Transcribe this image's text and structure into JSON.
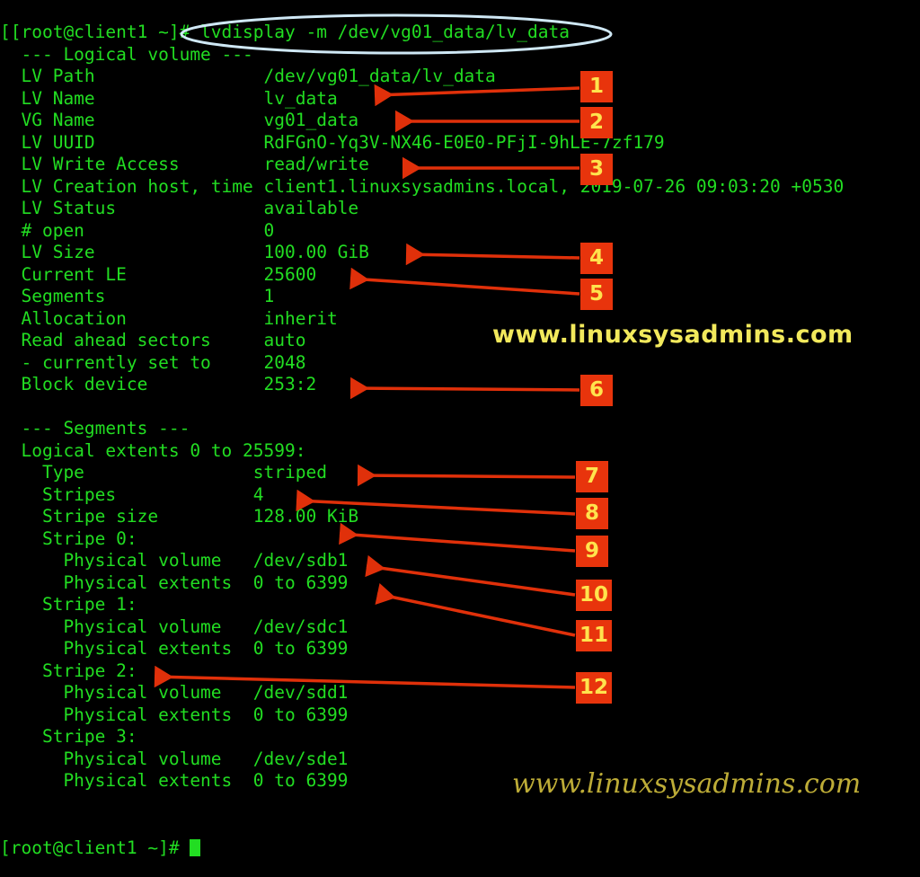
{
  "window": {
    "title": "lvdisplay -m /dev/vg01_data/lv_data",
    "background_color": "#000000",
    "text_color": "#22dd22",
    "badge_color": "#e8340c",
    "badge_text_color": "#ffe34d",
    "arrow_color": "#e0300a",
    "highlight_ellipse_color": "#cfe8f5"
  },
  "terminal": {
    "prompt_line": "[[root@client1 ~]# lvdisplay -m /dev/vg01_data/lv_data",
    "final_prompt": "[root@client1 ~]# ",
    "lines": [
      "[[root@client1 ~]# lvdisplay -m /dev/vg01_data/lv_data",
      "  --- Logical volume ---",
      "  LV Path                /dev/vg01_data/lv_data",
      "  LV Name                lv_data",
      "  VG Name                vg01_data",
      "  LV UUID                RdFGnO-Yq3V-NX46-E0E0-PFjI-9hLE-7zf179",
      "  LV Write Access        read/write",
      "  LV Creation host, time client1.linuxsysadmins.local, 2019-07-26 09:03:20 +0530",
      "  LV Status              available",
      "  # open                 0",
      "  LV Size                100.00 GiB",
      "  Current LE             25600",
      "  Segments               1",
      "  Allocation             inherit",
      "  Read ahead sectors     auto",
      "  - currently set to     2048",
      "  Block device           253:2",
      "",
      "  --- Segments ---",
      "  Logical extents 0 to 25599:",
      "    Type                striped",
      "    Stripes             4",
      "    Stripe size         128.00 KiB",
      "    Stripe 0:",
      "      Physical volume   /dev/sdb1",
      "      Physical extents  0 to 6399",
      "    Stripe 1:",
      "      Physical volume   /dev/sdc1",
      "      Physical extents  0 to 6399",
      "    Stripe 2:",
      "      Physical volume   /dev/sdd1",
      "      Physical extents  0 to 6399",
      "    Stripe 3:",
      "      Physical volume   /dev/sde1",
      "      Physical extents  0 to 6399"
    ],
    "fields": {
      "lv_path": {
        "label": "LV Path",
        "value": "/dev/vg01_data/lv_data"
      },
      "lv_name": {
        "label": "LV Name",
        "value": "lv_data"
      },
      "vg_name": {
        "label": "VG Name",
        "value": "vg01_data"
      },
      "lv_uuid": {
        "label": "LV UUID",
        "value": "RdFGnO-Yq3V-NX46-E0E0-PFjI-9hLE-7zf179"
      },
      "lv_write_access": {
        "label": "LV Write Access",
        "value": "read/write"
      },
      "lv_creation": {
        "label": "LV Creation host, time",
        "value": "client1.linuxsysadmins.local, 2019-07-26 09:03:20 +0530"
      },
      "lv_status": {
        "label": "LV Status",
        "value": "available"
      },
      "open_count": {
        "label": "# open",
        "value": "0"
      },
      "lv_size": {
        "label": "LV Size",
        "value": "100.00 GiB"
      },
      "current_le": {
        "label": "Current LE",
        "value": "25600"
      },
      "segments": {
        "label": "Segments",
        "value": "1"
      },
      "allocation": {
        "label": "Allocation",
        "value": "inherit"
      },
      "read_ahead": {
        "label": "Read ahead sectors",
        "value": "auto"
      },
      "currently_set_to": {
        "label": "- currently set to",
        "value": "2048"
      },
      "block_device": {
        "label": "Block device",
        "value": "253:2"
      },
      "seg_type": {
        "label": "Type",
        "value": "striped"
      },
      "seg_stripes": {
        "label": "Stripes",
        "value": "4"
      },
      "seg_stripe_size": {
        "label": "Stripe size",
        "value": "128.00 KiB"
      }
    },
    "headers": {
      "logical_volume": "  --- Logical volume ---",
      "segments": "  --- Segments ---",
      "logical_extents": "  Logical extents 0 to 25599:"
    },
    "stripes": [
      {
        "header": "    Stripe 0:",
        "pv_label": "      Physical volume",
        "pv_value": "/dev/sdb1",
        "pe_label": "      Physical extents",
        "pe_value": "0 to 6399"
      },
      {
        "header": "    Stripe 1:",
        "pv_label": "      Physical volume",
        "pv_value": "/dev/sdc1",
        "pe_label": "      Physical extents",
        "pe_value": "0 to 6399"
      },
      {
        "header": "    Stripe 2:",
        "pv_label": "      Physical volume",
        "pv_value": "/dev/sdd1",
        "pe_label": "      Physical extents",
        "pe_value": "0 to 6399"
      },
      {
        "header": "    Stripe 3:",
        "pv_label": "      Physical volume",
        "pv_value": "/dev/sde1",
        "pe_label": "      Physical extents",
        "pe_value": "0 to 6399"
      }
    ]
  },
  "annotations": {
    "badges": [
      {
        "n": "1",
        "target": "LV Path value"
      },
      {
        "n": "2",
        "target": "LV Name / VG Name value"
      },
      {
        "n": "3",
        "target": "LV Write Access value"
      },
      {
        "n": "4",
        "target": "LV Size value"
      },
      {
        "n": "5",
        "target": "Current LE value"
      },
      {
        "n": "6",
        "target": "Block device value"
      },
      {
        "n": "7",
        "target": "Type striped"
      },
      {
        "n": "8",
        "target": "Stripes 4"
      },
      {
        "n": "9",
        "target": "Stripe size"
      },
      {
        "n": "10",
        "target": "Stripe 0 physical volume"
      },
      {
        "n": "11",
        "target": "Stripe 0 physical extents"
      },
      {
        "n": "12",
        "target": "Stripe 2 header"
      }
    ]
  },
  "watermarks": {
    "top": "www.linuxsysadmins.com",
    "bottom": "www.linuxsysadmins.com"
  }
}
